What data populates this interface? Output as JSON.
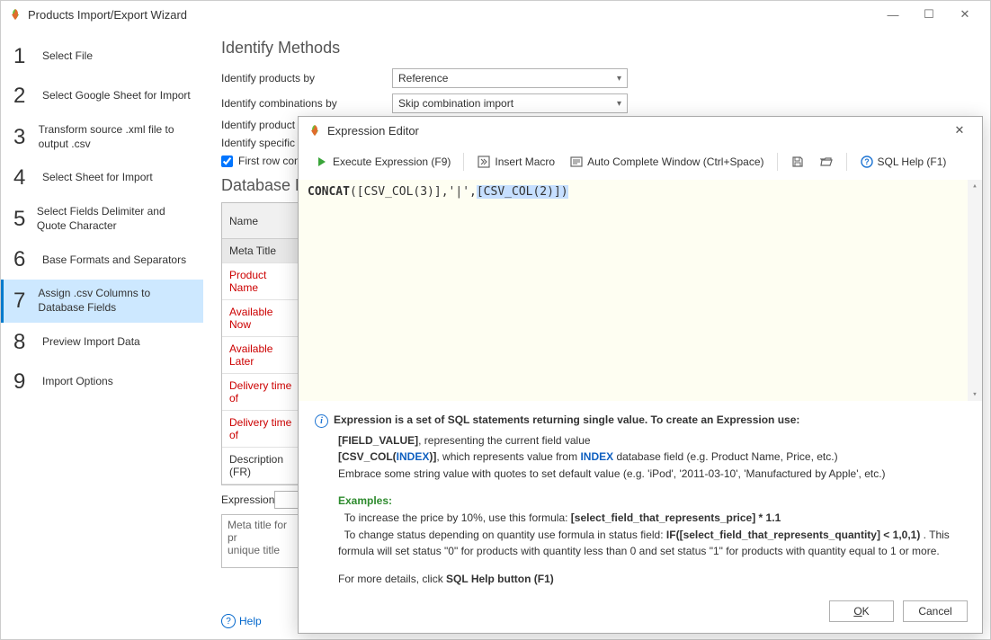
{
  "window": {
    "title": "Products Import/Export Wizard"
  },
  "steps": [
    {
      "num": "1",
      "label": "Select File"
    },
    {
      "num": "2",
      "label": "Select Google Sheet for Import"
    },
    {
      "num": "3",
      "label": "Transform source .xml file to output .csv"
    },
    {
      "num": "4",
      "label": "Select Sheet for Import"
    },
    {
      "num": "5",
      "label": "Select Fields Delimiter and Quote Character"
    },
    {
      "num": "6",
      "label": "Base Formats and Separators"
    },
    {
      "num": "7",
      "label": "Assign .csv Columns to Database Fields"
    },
    {
      "num": "8",
      "label": "Preview Import Data"
    },
    {
      "num": "9",
      "label": "Import Options"
    }
  ],
  "active_step_index": 6,
  "identify": {
    "section_title": "Identify Methods",
    "rows": [
      {
        "label": "Identify products by",
        "value": "Reference"
      },
      {
        "label": "Identify combinations by",
        "value": "Skip combination import"
      },
      {
        "label": "Identify product",
        "value": ""
      },
      {
        "label": "Identify specific",
        "value": ""
      }
    ],
    "first_row_checkbox": "First row con"
  },
  "db": {
    "section_title": "Database F",
    "name_header": "Name",
    "rows": [
      {
        "text": "Meta Title",
        "cls": "meta"
      },
      {
        "text": "Product Name",
        "cls": "red"
      },
      {
        "text": "Available Now",
        "cls": "red"
      },
      {
        "text": "Available Later",
        "cls": "red"
      },
      {
        "text": "Delivery time of",
        "cls": "red"
      },
      {
        "text": "Delivery time of",
        "cls": "red"
      },
      {
        "text": "Description (FR)",
        "cls": ""
      }
    ],
    "expression_label": "Expression",
    "desc_text": "Meta title for pr\nunique title"
  },
  "help_label": "Help",
  "modal": {
    "title": "Expression Editor",
    "toolbar": {
      "execute": "Execute Expression (F9)",
      "insert_macro": "Insert Macro",
      "autocomplete": "Auto Complete Window (Ctrl+Space)",
      "sql_help": "SQL Help (F1)"
    },
    "code": {
      "fn": "CONCAT",
      "body_before": "([CSV_COL(3)],'|',",
      "sel": "[CSV_COL(2)])"
    },
    "info": {
      "intro": "Expression is a set of SQL statements returning single value. To create an Expression use:",
      "field_value": "[FIELD_VALUE]",
      "field_value_desc": ", representing the current field value",
      "csv_col_pre": "[CSV_COL(",
      "csv_col_idx": "INDEX",
      "csv_col_post": ")]",
      "csv_col_desc1": ", which represents value from ",
      "csv_col_desc2": " database field (e.g. Product Name, Price, etc.)",
      "embrace": "Embrace some string value with quotes to set default value (e.g. 'iPod', '2011-03-10', 'Manufactured by Apple', etc.)",
      "examples_label": "Examples:",
      "ex1_pre": "To increase the price by 10%, use this formula: ",
      "ex1_bold": "[select_field_that_represents_price] * 1.1",
      "ex2_pre": "To change status depending on quantity use formula in status field: ",
      "ex2_bold": "IF([select_field_that_represents_quantity] < 1,0,1)",
      "ex2_post": " . This formula will set status \"0\" for products with quantity less than 0 and set status \"1\" for products with quantity equal to 1 or more.",
      "more_pre": "For more details, click ",
      "more_bold": "SQL Help button (F1)"
    },
    "buttons": {
      "ok": "OK",
      "cancel": "Cancel"
    }
  }
}
